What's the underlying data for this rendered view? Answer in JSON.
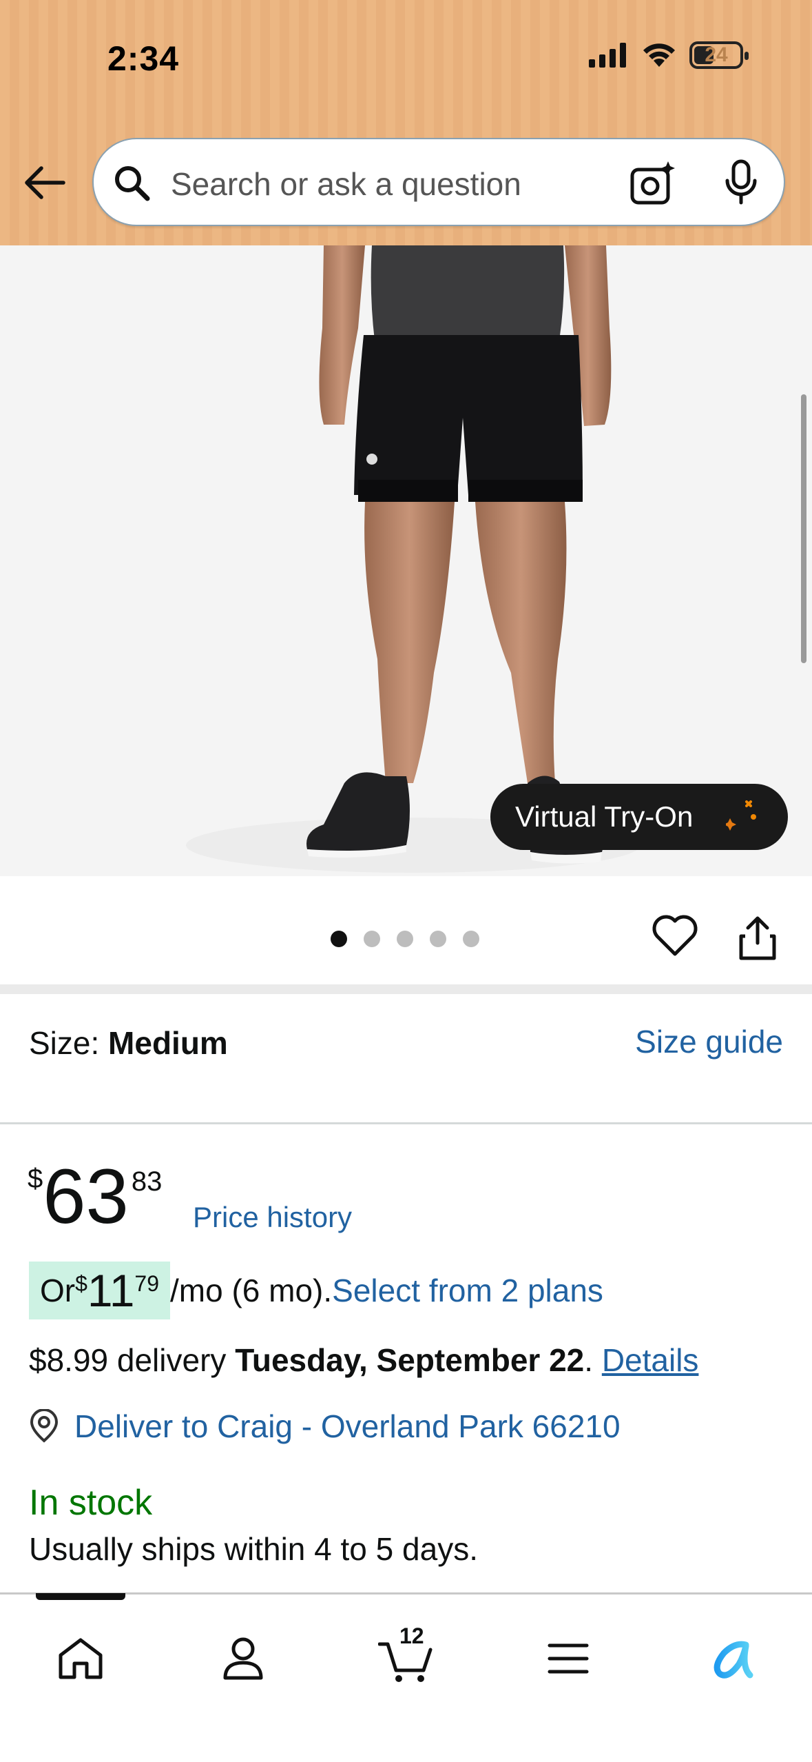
{
  "status_bar": {
    "time": "2:34",
    "battery": "24"
  },
  "search": {
    "placeholder": "Search or ask a question"
  },
  "product": {
    "virtual_tryon_label": "Virtual Try-On",
    "image_count": 5,
    "active_image_index": 0
  },
  "size": {
    "label": "Size: ",
    "value": "Medium",
    "guide_link": "Size guide"
  },
  "price": {
    "symbol": "$",
    "whole": "63",
    "fraction": "83",
    "history_link": "Price history"
  },
  "installment": {
    "prefix": "Or ",
    "symbol": "$",
    "whole": "11",
    "fraction": "79",
    "term": "/mo (6 mo).",
    "plans_link": "Select from 2 plans"
  },
  "delivery": {
    "fee_text": "$8.99 delivery ",
    "date": "Tuesday, September 22",
    "period": ". ",
    "details_link": "Details"
  },
  "deliver_to": {
    "text": "Deliver to Craig - Overland Park 66210"
  },
  "stock": {
    "status": "In stock",
    "shipping_note": "Usually ships within 4 to 5 days."
  },
  "bottom_nav": {
    "items": [
      "home",
      "account",
      "cart",
      "menu",
      "rufus"
    ],
    "cart_count": "12",
    "active": "home"
  },
  "colors": {
    "header_bg": "#ecb783",
    "link": "#2162a1",
    "in_stock": "#007600",
    "installment_highlight": "#cdf2e3"
  }
}
